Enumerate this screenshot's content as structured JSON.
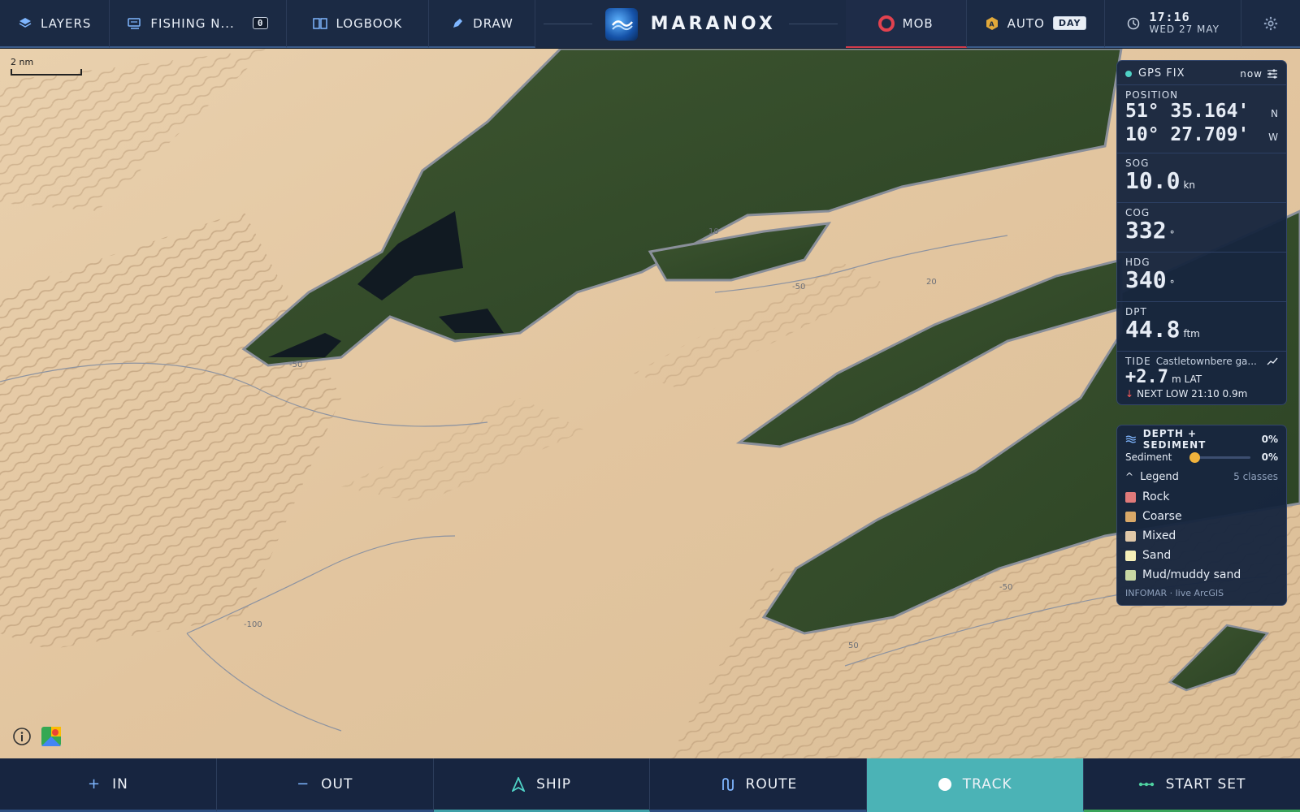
{
  "topbar": {
    "layers": "LAYERS",
    "fishing": "FISHING N...",
    "fishing_count": "0",
    "logbook": "LOGBOOK",
    "draw": "DRAW",
    "brand": "MARANOX",
    "mob": "MOB",
    "auto": "AUTO",
    "auto_badge": "A",
    "day": "DAY",
    "time": "17:16",
    "date": "WED 27 MAY"
  },
  "map": {
    "scale_label": "2 nm",
    "depth_labels": [
      "10",
      "-50",
      "-50",
      "20",
      "-100",
      "50",
      "-50"
    ]
  },
  "gps": {
    "title": "GPS FIX",
    "age": "now",
    "position_label": "POSITION",
    "lat": "51° 35.164'",
    "lat_hemi": "N",
    "lon": "10° 27.709'",
    "lon_hemi": "W",
    "sog_label": "SOG",
    "sog": "10.0",
    "sog_unit": "kn",
    "cog_label": "COG",
    "cog": "332",
    "cog_unit": "°",
    "hdg_label": "HDG",
    "hdg": "340",
    "hdg_unit": "°",
    "dpt_label": "DPT",
    "dpt": "44.8",
    "dpt_unit": "ftm",
    "tide_label": "TIDE",
    "tide_station": "Castletownbere ga...",
    "tide_value": "+2.7",
    "tide_unit": "m LAT",
    "next_low": "NEXT LOW 21:10  0.9m"
  },
  "sediment": {
    "title": "DEPTH + SEDIMENT",
    "title_pct": "0%",
    "slider_label": "Sediment",
    "slider_pct": "0%",
    "slider_value": 0,
    "legend_label": "Legend",
    "legend_count": "5 classes",
    "items": [
      {
        "label": "Rock",
        "color": "#e07a7a"
      },
      {
        "label": "Coarse",
        "color": "#d8a868"
      },
      {
        "label": "Mixed",
        "color": "#e0c8a8"
      },
      {
        "label": "Sand",
        "color": "#f6efb8"
      },
      {
        "label": "Mud/muddy sand",
        "color": "#c9d8a4"
      }
    ],
    "source": "INFOMAR · live ArcGIS"
  },
  "bottombar": {
    "in": "IN",
    "out": "OUT",
    "ship": "SHIP",
    "route": "ROUTE",
    "track": "TRACK",
    "start_set": "START SET"
  },
  "colors": {
    "accent_active": "#4bb3b6",
    "mob_red": "#e2424f",
    "panel_bg": "#17253e"
  }
}
